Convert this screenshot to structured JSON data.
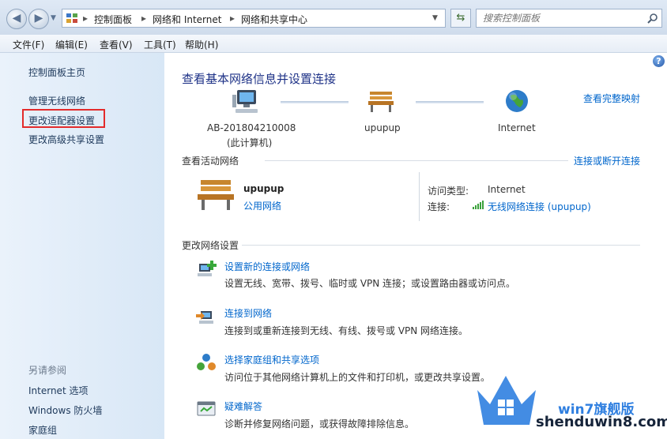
{
  "address": {
    "crumbs": [
      "控制面板",
      "网络和 Internet",
      "网络和共享中心"
    ],
    "search_placeholder": "搜索控制面板"
  },
  "menu": {
    "file": "文件(F)",
    "edit": "编辑(E)",
    "view": "查看(V)",
    "tools": "工具(T)",
    "help": "帮助(H)"
  },
  "sidebar": {
    "home": "控制面板主页",
    "items": [
      "管理无线网络",
      "更改适配器设置",
      "更改高级共享设置"
    ],
    "see_also_title": "另请参阅",
    "see_also": [
      "Internet 选项",
      "Windows 防火墙",
      "家庭组"
    ]
  },
  "main": {
    "title": "查看基本网络信息并设置连接",
    "full_map_link": "查看完整映射",
    "map": {
      "computer_name": "AB-201804210008",
      "computer_sub": "(此计算机)",
      "network_name": "upupup",
      "internet": "Internet"
    },
    "active_title": "查看活动网络",
    "connect_disconnect": "连接或断开连接",
    "active": {
      "name": "upupup",
      "type": "公用网络",
      "access_label": "访问类型:",
      "access_value": "Internet",
      "conn_label": "连接:",
      "conn_value": "无线网络连接 (upupup)"
    },
    "change_title": "更改网络设置",
    "tasks": [
      {
        "title": "设置新的连接或网络",
        "desc": "设置无线、宽带、拨号、临时或 VPN 连接；或设置路由器或访问点。",
        "icon": "new-connection-icon"
      },
      {
        "title": "连接到网络",
        "desc": "连接到或重新连接到无线、有线、拨号或 VPN 网络连接。",
        "icon": "connect-network-icon"
      },
      {
        "title": "选择家庭组和共享选项",
        "desc": "访问位于其他网络计算机上的文件和打印机，或更改共享设置。",
        "icon": "homegroup-icon"
      },
      {
        "title": "疑难解答",
        "desc": "诊断并修复网络问题，或获得故障排除信息。",
        "icon": "troubleshoot-icon"
      }
    ]
  },
  "watermark": {
    "brand": "win7旗舰版",
    "site": "shenduwin8.com"
  }
}
